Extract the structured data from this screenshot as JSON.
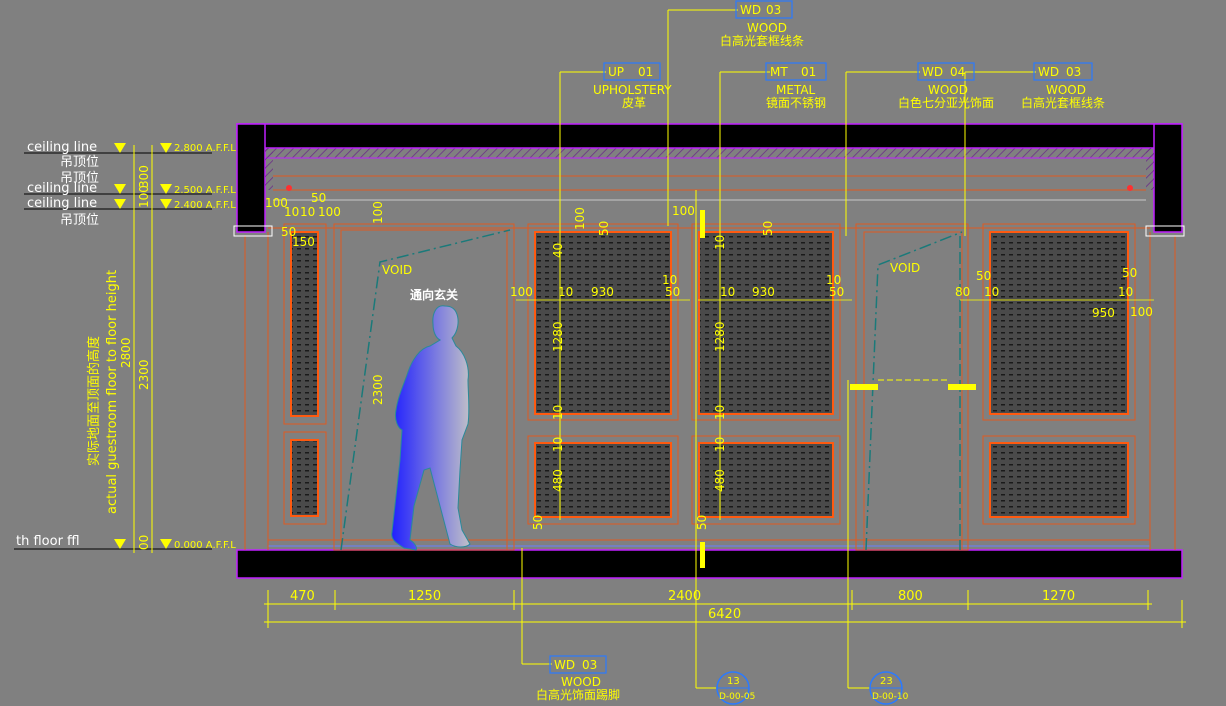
{
  "tags": {
    "top_wood": {
      "code": "WD",
      "num": "03",
      "material": "WOOD",
      "desc": "白高光套框线条"
    },
    "upholstery": {
      "code": "UP",
      "num": "01",
      "material": "UPHOLSTERY",
      "desc": "皮革"
    },
    "metal": {
      "code": "MT",
      "num": "01",
      "material": "METAL",
      "desc": "镜面不锈钢"
    },
    "wood_04": {
      "code": "WD",
      "num": "04",
      "material": "WOOD",
      "desc": "白色七分亚光饰面"
    },
    "wood_03b": {
      "code": "WD",
      "num": "03",
      "material": "WOOD",
      "desc": "白高光套框线条"
    },
    "bottom_wood": {
      "code": "WD",
      "num": "03",
      "material": "WOOD",
      "desc": "白高光饰面踢脚"
    }
  },
  "levels": {
    "ceiling1": {
      "label": "ceiling line",
      "sub": "吊顶位",
      "value": "2.800 A.F.F.L"
    },
    "ceiling2": {
      "label": "ceiling line",
      "sub": "吊顶位",
      "value": "2.500 A.F.F.L"
    },
    "ceiling3": {
      "label": "ceiling line",
      "sub": "吊顶位",
      "value": "2.400 A.F.F.L"
    },
    "floor": {
      "label": "th floor ffl",
      "value": "0.000 A.F.F.L"
    }
  },
  "left_dims": {
    "d300": "300",
    "d100": "100",
    "d2300": "2300",
    "d2800": "2800",
    "d0": "00",
    "caption_cn": "实际地面至顶面的高度",
    "caption_en": "actual guestroom floor to floor height"
  },
  "bottom_dims": [
    "470",
    "1250",
    "2400",
    "800",
    "1270"
  ],
  "total_dim": "6420",
  "void_labels": {
    "left": "VOID",
    "right": "VOID"
  },
  "entrance_label": "通向玄关",
  "section_markers": {
    "left": {
      "num": "13",
      "ref": "D-00-05"
    },
    "right": {
      "num": "23",
      "ref": "D-00-10"
    }
  },
  "inner_dims": {
    "d50a": "50",
    "d100a": "100",
    "d10a": "10",
    "d10b": "10",
    "d100b": "100",
    "d100c": "100",
    "d50b": "50",
    "d150": "150",
    "d2300b": "2300",
    "d100d": "100",
    "d50c": "50",
    "p1_40": "40",
    "p1_100": "100",
    "p1_50": "50",
    "p1_100l": "100",
    "p1_10a": "10",
    "p1_930": "930",
    "p1_50r": "50",
    "p1_10r": "10",
    "p1_1280": "1280",
    "p1_10b": "10",
    "p1_10c": "10",
    "p1_480": "480",
    "p1_50b": "50",
    "p2_10": "10",
    "p2_50": "50",
    "p2_10a": "10",
    "p2_930": "930",
    "p2_50r": "50",
    "p2_10r": "10",
    "p2_1280": "1280",
    "p2_10b": "10",
    "p2_10c": "10",
    "p2_480": "480",
    "p2_50b": "50",
    "p3_50": "50",
    "p3_80": "80",
    "p3_10": "10",
    "p3_50r": "50",
    "p3_10r": "10",
    "p3_950": "950",
    "p3_100": "100"
  }
}
